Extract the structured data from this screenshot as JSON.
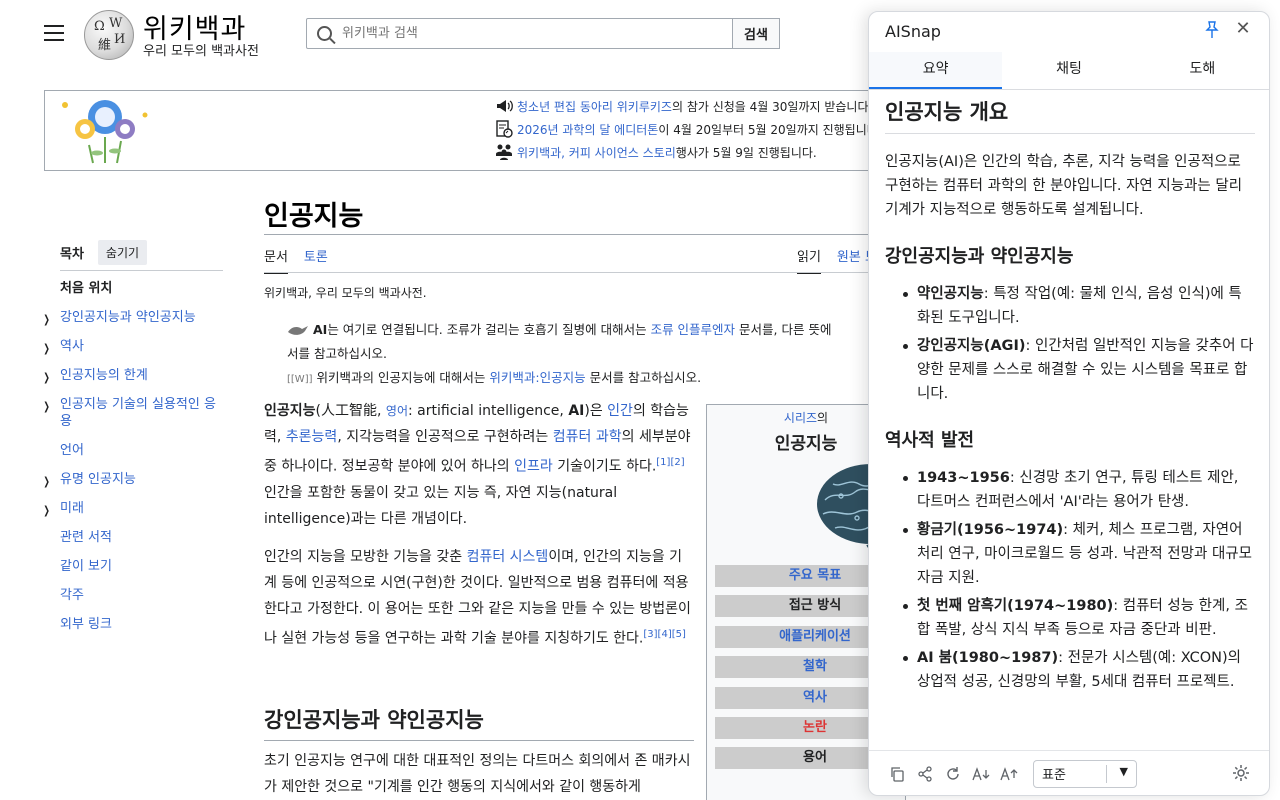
{
  "header": {
    "site_title": "위키백과",
    "site_tagline": "우리 모두의 백과사전",
    "search_placeholder": "위키백과 검색",
    "search_button": "검색"
  },
  "notice": {
    "items": [
      {
        "link": "청소년 편집 동아리 위키루키즈",
        "text": "의 참가 신청을 4월 30일까지 받습니다."
      },
      {
        "link": "2026년 과학의 달 에디터톤",
        "text": "이 4월 20일부터 5월 20일까지 진행됩니다."
      },
      {
        "link": "위키백과, 커피 사이언스 스토리",
        "text": " 행사가 5월 9일 진행됩니다."
      }
    ]
  },
  "toc": {
    "title": "목차",
    "hide_button": "숨기기",
    "items": [
      {
        "label": "처음 위치",
        "expandable": false,
        "current": true
      },
      {
        "label": "강인공지능과 약인공지능",
        "expandable": true
      },
      {
        "label": "역사",
        "expandable": true
      },
      {
        "label": "인공지능의 한계",
        "expandable": true
      },
      {
        "label": "인공지능 기술의 실용적인 응용",
        "expandable": true
      },
      {
        "label": "언어",
        "expandable": false
      },
      {
        "label": "유명 인공지능",
        "expandable": true
      },
      {
        "label": "미래",
        "expandable": true
      },
      {
        "label": "관련 서적",
        "expandable": false
      },
      {
        "label": "같이 보기",
        "expandable": false
      },
      {
        "label": "각주",
        "expandable": false
      },
      {
        "label": "외부 링크",
        "expandable": false
      }
    ]
  },
  "article": {
    "title": "인공지능",
    "tab_article": "문서",
    "tab_talk": "토론",
    "tab_read": "읽기",
    "tab_source": "원본 보",
    "from_wiki": "위키백과, 우리 모두의 백과사전.",
    "hatnote1_a": "AI",
    "hatnote1_b": "는 여기로 연결됩니다. 조류가 걸리는 호흡기 질병에 대해서는 ",
    "hatnote1_link": "조류 인플루엔자",
    "hatnote1_c": " 문서를, 다른 뜻에",
    "hatnote1_d": "서를 참고하십시오.",
    "hatnote2_icon": "[[W]]",
    "hatnote2_a": "위키백과의 인공지능에 대해서는 ",
    "hatnote2_link": "위키백과:인공지능",
    "hatnote2_b": " 문서를 참고하십시오.",
    "p1": {
      "bold": "인공지능",
      "t1": "(人工智能, ",
      "lang": "영어",
      "t2": ": artificial intelligence, ",
      "bold2": "AI",
      "t3": ")은 ",
      "l1": "인간",
      "t4": "의 학습능력, ",
      "l2": "추론능력",
      "t5": ", 지각능력을 인공적으로 구현하려는 ",
      "l3": "컴퓨터 과학",
      "t6": "의 세부분야 중 하나이다. 정보공학 분야에 있어 하나의 ",
      "l4": "인프라",
      "t7": " 기술이기도 하다.",
      "refs": "[1][2]",
      "t8": " 인간을 포함한 동물이 갖고 있는 지능 즉, 자연 지능(natural intelligence)과는 다른 개념이다."
    },
    "p2": {
      "t1": "인간의 지능을 모방한 기능을 갖춘 ",
      "l1": "컴퓨터 시스템",
      "t2": "이며, 인간의 지능을 기계 등에 인공적으로 시연(구현)한 것이다. 일반적으로 범용 컴퓨터에 적용한다고 가정한다. 이 용어는 또한 그와 같은 지능을 만들 수 있는 방법론이나 실현 가능성 등을 연구하는 과학 기술 분야를 지칭하기도 한다.",
      "refs": "[3][4][5]"
    },
    "section_heading": "강인공지능과 약인공지능",
    "p3": "초기 인공지능 연구에 대한 대표적인 정의는 다트머스 회의에서 존 매카시가 제안한 것으로 \"기계를 인간 행동의 지식에서와 같이 행동하게"
  },
  "infobox": {
    "series_link": "시리즈",
    "series_rest": "의",
    "title": "인공지능",
    "rows": [
      {
        "label": "주요 목표",
        "color": "#3366cc"
      },
      {
        "label": "접근 방식",
        "color": "#202122"
      },
      {
        "label": "애플리케이션",
        "color": "#3366cc"
      },
      {
        "label": "철학",
        "color": "#3366cc"
      },
      {
        "label": "역사",
        "color": "#3366cc"
      },
      {
        "label": "논란",
        "color": "#d33"
      },
      {
        "label": "용어",
        "color": "#202122"
      }
    ]
  },
  "panel": {
    "name": "AISnap",
    "tabs": [
      "요약",
      "채팅",
      "도해"
    ],
    "active_tab": 0,
    "heading": "인공지능 개요",
    "intro": "인공지능(AI)은 인간의 학습, 추론, 지각 능력을 인공적으로 구현하는 컴퓨터 과학의 한 분야입니다. 자연 지능과는 달리 기계가 지능적으로 행동하도록 설계됩니다.",
    "section1": {
      "title": "강인공지능과 약인공지능",
      "items": [
        {
          "term": "약인공지능",
          "desc": ": 특정 작업(예: 물체 인식, 음성 인식)에 특화된 도구입니다."
        },
        {
          "term": "강인공지능(AGI)",
          "desc": ": 인간처럼 일반적인 지능을 갖추어 다양한 문제를 스스로 해결할 수 있는 시스템을 목표로 합니다."
        }
      ]
    },
    "section2": {
      "title": "역사적 발전",
      "items": [
        {
          "term": "1943~1956",
          "desc": ": 신경망 초기 연구, 튜링 테스트 제안, 다트머스 컨퍼런스에서 'AI'라는 용어가 탄생."
        },
        {
          "term": "황금기(1956~1974)",
          "desc": ": 체커, 체스 프로그램, 자연어 처리 연구, 마이크로월드 등 성과. 낙관적 전망과 대규모 자금 지원."
        },
        {
          "term": "첫 번째 암흑기(1974~1980)",
          "desc": ": 컴퓨터 성능 한계, 조합 폭발, 상식 지식 부족 등으로 자금 중단과 비판."
        },
        {
          "term": "AI 붐(1980~1987)",
          "desc": ": 전문가 시스템(예: XCON)의 상업적 성공, 신경망의 부활, 5세대 컴퓨터 프로젝트."
        }
      ]
    },
    "footer": {
      "font_size_select": "표준"
    },
    "accent": "#1a73e8"
  }
}
